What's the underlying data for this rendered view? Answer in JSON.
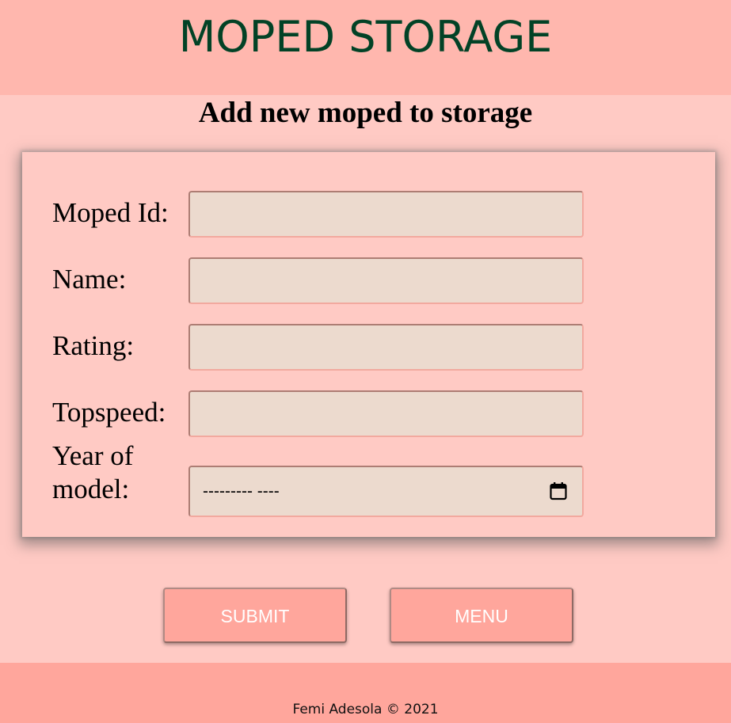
{
  "header": {
    "title": "MOPED STORAGE",
    "title_color": "#024226",
    "background": "#ffb7ae"
  },
  "page": {
    "heading": "Add new moped to storage",
    "background": "#ffcac4"
  },
  "form": {
    "fields": [
      {
        "label": "Moped Id:",
        "value": "",
        "type": "text"
      },
      {
        "label": "Name:",
        "value": "",
        "type": "text"
      },
      {
        "label": "Rating:",
        "value": "",
        "type": "text"
      },
      {
        "label": "Topspeed:",
        "value": "",
        "type": "text"
      },
      {
        "label_line1": "Year of",
        "label_line2": "model:",
        "value": "--------- ----",
        "type": "date",
        "icon": "calendar-icon"
      }
    ],
    "input_background": "#ecdace"
  },
  "buttons": {
    "submit_label": "SUBMIT",
    "menu_label": "MENU",
    "background": "#ffa69c"
  },
  "footer": {
    "text": "Femi Adesola © 2021",
    "background": "#ffa69c"
  }
}
